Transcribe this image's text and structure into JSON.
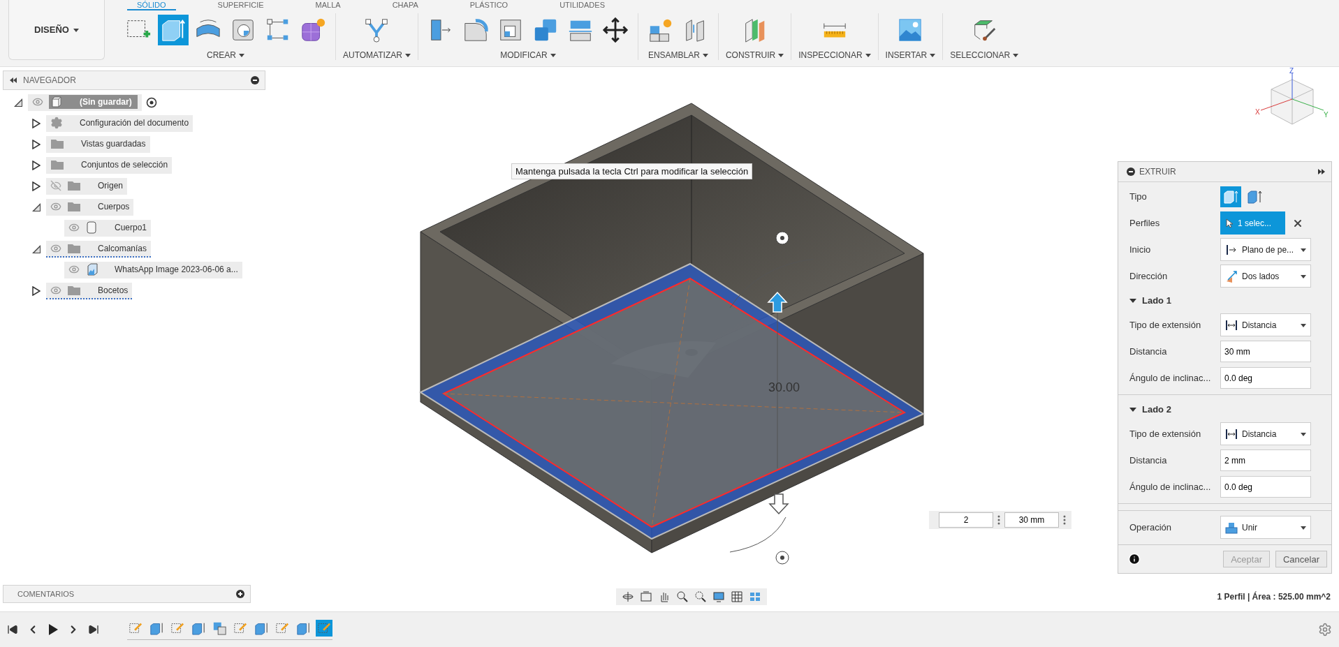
{
  "workspace_button": {
    "label": "DISEÑO"
  },
  "tabs": [
    {
      "label": "SÓLIDO",
      "selected": true
    },
    {
      "label": "SUPERFICIE",
      "selected": false
    },
    {
      "label": "MALLA",
      "selected": false
    },
    {
      "label": "CHAPA",
      "selected": false
    },
    {
      "label": "PLÁSTICO",
      "selected": false
    },
    {
      "label": "UTILIDADES",
      "selected": false
    }
  ],
  "tool_groups": [
    {
      "label": "CREAR",
      "tools": [
        {
          "selected": false
        },
        {
          "selected": true
        },
        {
          "selected": false
        },
        {
          "selected": false
        },
        {
          "selected": false
        },
        {
          "selected": false
        }
      ]
    },
    {
      "label": "AUTOMATIZAR",
      "tools": [
        {
          "selected": false
        }
      ]
    },
    {
      "label": "MODIFICAR",
      "tools": [
        {
          "selected": false
        },
        {
          "selected": false
        },
        {
          "selected": false
        },
        {
          "selected": false
        },
        {
          "selected": false
        },
        {
          "selected": false
        }
      ]
    },
    {
      "label": "ENSAMBLAR",
      "tools": [
        {
          "selected": false
        },
        {
          "selected": false
        }
      ]
    },
    {
      "label": "CONSTRUIR",
      "tools": [
        {
          "selected": false
        }
      ]
    },
    {
      "label": "INSPECCIONAR",
      "tools": [
        {
          "selected": false
        }
      ]
    },
    {
      "label": "INSERTAR",
      "tools": [
        {
          "selected": false
        }
      ]
    },
    {
      "label": "SELECCIONAR",
      "tools": [
        {
          "selected": false
        }
      ]
    }
  ],
  "navigator": {
    "title": "NAVEGADOR",
    "root": {
      "label": "(Sin guardar)",
      "kind": "component",
      "visible": true,
      "expanded": true,
      "active": true,
      "flagged": false,
      "children": [
        {
          "label": "Configuración del documento",
          "kind": "settings",
          "expanded": false,
          "flagged": false
        },
        {
          "label": "Vistas guardadas",
          "kind": "folder",
          "expanded": false,
          "flagged": false
        },
        {
          "label": "Conjuntos de selección",
          "kind": "folder",
          "expanded": false,
          "flagged": false
        },
        {
          "label": "Origen",
          "kind": "folder",
          "expanded": false,
          "visible": false,
          "flagged": false
        },
        {
          "label": "Cuerpos",
          "kind": "folder",
          "expanded": true,
          "visible": true,
          "flagged": false,
          "children": [
            {
              "label": "Cuerpo1",
              "kind": "body",
              "visible": true,
              "flagged": false
            }
          ]
        },
        {
          "label": "Calcomanías",
          "kind": "folder",
          "expanded": true,
          "visible": true,
          "flagged": true,
          "children": [
            {
              "label": "WhatsApp Image 2023-06-06 a...",
              "kind": "decal",
              "visible": true,
              "flagged": false
            }
          ]
        },
        {
          "label": "Bocetos",
          "kind": "folder",
          "expanded": false,
          "visible": true,
          "flagged": true
        }
      ]
    }
  },
  "comments": {
    "title": "COMENTARIOS"
  },
  "viewport": {
    "tooltip": "Mantenga pulsada la tecla Ctrl para modificar la selección",
    "dimension": "30.00",
    "inputs": [
      "2",
      "30 mm"
    ],
    "view_cube_axes": [
      "Z",
      "X",
      "Y"
    ]
  },
  "command_panel": {
    "title": "EXTRUIR",
    "rows": [
      {
        "kind": "type",
        "label": "Tipo",
        "options": [
          {
            "selected": true
          },
          {
            "selected": false
          }
        ]
      },
      {
        "kind": "selection",
        "label": "Perfiles",
        "value": "1 selec..."
      },
      {
        "kind": "dropdown",
        "label": "Inicio",
        "value": "Plano de pe..."
      },
      {
        "kind": "dropdown",
        "label": "Dirección",
        "value": "Dos lados"
      },
      {
        "kind": "section",
        "label": "Lado 1",
        "expanded": true
      },
      {
        "kind": "dropdown",
        "label": "Tipo de extensión",
        "value": "Distancia"
      },
      {
        "kind": "field",
        "label": "Distancia",
        "value": "30 mm"
      },
      {
        "kind": "field",
        "label": "Ángulo de inclinac...",
        "value": "0.0 deg"
      },
      {
        "kind": "divider"
      },
      {
        "kind": "section",
        "label": "Lado 2",
        "expanded": true
      },
      {
        "kind": "dropdown",
        "label": "Tipo de extensión",
        "value": "Distancia"
      },
      {
        "kind": "field",
        "label": "Distancia",
        "value": "2 mm"
      },
      {
        "kind": "field",
        "label": "Ángulo de inclinac...",
        "value": "0.0 deg"
      },
      {
        "kind": "divider"
      },
      {
        "kind": "divider"
      },
      {
        "kind": "dropdown",
        "label": "Operación",
        "value": "Unir"
      }
    ],
    "buttons": [
      {
        "label": "Aceptar",
        "disabled": true
      },
      {
        "label": "Cancelar",
        "disabled": false
      }
    ]
  },
  "status": "1 Perfil | Área : 525.00 mm^2",
  "timeline": {
    "features": [
      {
        "kind": "sketch",
        "selected": false
      },
      {
        "kind": "extrude",
        "selected": false
      },
      {
        "kind": "sketch",
        "selected": false
      },
      {
        "kind": "extrude",
        "selected": false
      },
      {
        "kind": "combine",
        "selected": false
      },
      {
        "kind": "sketch",
        "selected": false
      },
      {
        "kind": "extrude",
        "selected": false
      },
      {
        "kind": "sketch",
        "selected": false
      },
      {
        "kind": "extrude",
        "selected": false
      },
      {
        "kind": "sketch",
        "selected": true
      }
    ]
  }
}
